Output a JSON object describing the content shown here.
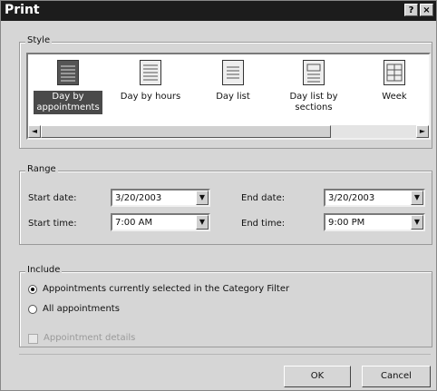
{
  "window": {
    "title": "Print",
    "help_label": "?",
    "close_label": "×"
  },
  "style_group": {
    "label": "Style",
    "items": [
      {
        "label": "Day by appointments",
        "icon": "day-by-appointments-icon",
        "selected": true
      },
      {
        "label": "Day by hours",
        "icon": "day-by-hours-icon",
        "selected": false
      },
      {
        "label": "Day list",
        "icon": "day-list-icon",
        "selected": false
      },
      {
        "label": "Day list by sections",
        "icon": "day-list-by-sections-icon",
        "selected": false
      },
      {
        "label": "Week",
        "icon": "week-icon",
        "selected": false
      }
    ],
    "scroll_left": "◄",
    "scroll_right": "►"
  },
  "range_group": {
    "label": "Range",
    "start_date": {
      "label": "Start date:",
      "value": "3/20/2003"
    },
    "end_date": {
      "label": "End date:",
      "value": "3/20/2003"
    },
    "start_time": {
      "label": "Start time:",
      "value": "7:00 AM"
    },
    "end_time": {
      "label": "End time:",
      "value": "9:00 PM"
    },
    "dropdown_arrow": "▼"
  },
  "include_group": {
    "label": "Include",
    "options": [
      {
        "label": "Appointments currently selected in the Category Filter",
        "selected": true
      },
      {
        "label": "All appointments",
        "selected": false
      }
    ],
    "checkbox": {
      "label": "Appointment details",
      "checked": false,
      "enabled": false
    }
  },
  "buttons": {
    "ok": "OK",
    "cancel": "Cancel"
  }
}
